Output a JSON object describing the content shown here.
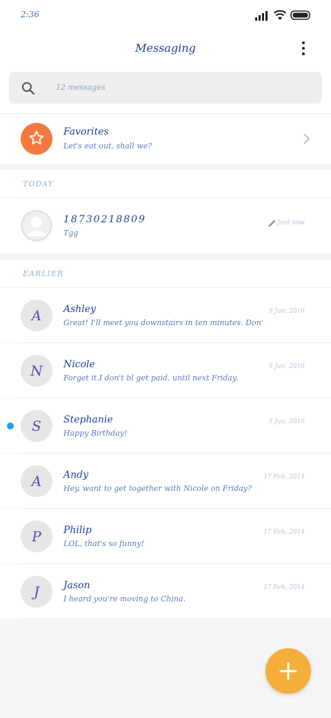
{
  "status_bar": {
    "time": "2:36",
    "icons": [
      "signal-icon",
      "wifi-icon",
      "battery-icon"
    ]
  },
  "header": {
    "title": "Messaging",
    "menu_icon": "more-vertical-icon"
  },
  "search": {
    "placeholder": "12 messages",
    "icon": "search-icon"
  },
  "favorites": {
    "title": "Favorites",
    "preview": "Let's eat out, shall we?",
    "icon": "star-icon",
    "color": "#f37a3f"
  },
  "sections": {
    "today": "TODAY",
    "earlier": "EARLIER"
  },
  "today_conversations": [
    {
      "name": "18730218809",
      "preview": "Tgg",
      "time": "Just now",
      "status_icon": "edit-draft-icon",
      "avatar_icon": "person-icon"
    }
  ],
  "earlier_conversations": [
    {
      "initial": "A",
      "name": "Ashley",
      "preview": "Great! I'll meet you downstairs in ten minutes. Don't forge",
      "time": "9 Jun, 2016",
      "unread": false
    },
    {
      "initial": "N",
      "name": "Nicole",
      "preview": "Forget it.I don't bl get paid. until next Friday.",
      "time": "9 Jun, 2016",
      "unread": false
    },
    {
      "initial": "S",
      "name": "Stephanie",
      "preview": "Happy Birthday!",
      "time": "8 Jun, 2016",
      "unread": true
    },
    {
      "initial": "A",
      "name": "Andy",
      "preview": "Hey, want to get together with Nicole on Friday?",
      "time": "17 Feb, 2014",
      "unread": false
    },
    {
      "initial": "P",
      "name": "Philip",
      "preview": "LOL, that's so funny!",
      "time": "17 Feb, 2014",
      "unread": false
    },
    {
      "initial": "J",
      "name": "Jason",
      "preview": "I heard you're moving to China.",
      "time": "17 Feb, 2014",
      "unread": false
    }
  ],
  "fab": {
    "icon": "plus-icon",
    "color": "#f6ae3a"
  },
  "colors": {
    "accent_blue": "#1c3f94",
    "unread_dot": "#1e9ef0"
  }
}
